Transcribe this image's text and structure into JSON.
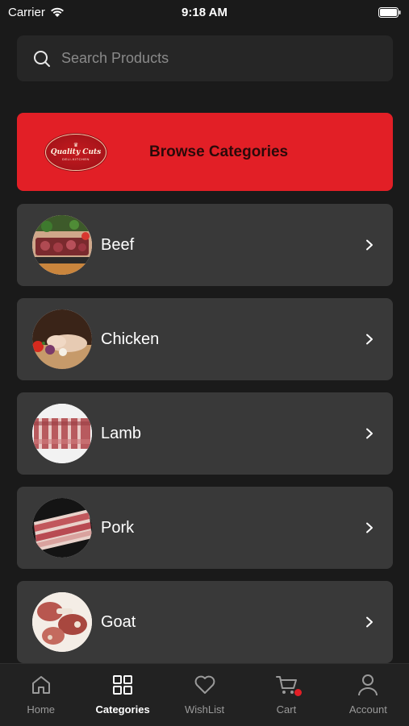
{
  "status": {
    "carrier": "Carrier",
    "time": "9:18 AM"
  },
  "search": {
    "placeholder": "Search Products"
  },
  "banner": {
    "title": "Browse Categories",
    "logo_text": "Quality Cuts",
    "logo_subtext": "DELI-KITCHEN"
  },
  "categories": [
    {
      "label": "Beef"
    },
    {
      "label": "Chicken"
    },
    {
      "label": "Lamb"
    },
    {
      "label": "Pork"
    },
    {
      "label": "Goat"
    }
  ],
  "tabbar": {
    "items": [
      {
        "label": "Home",
        "icon": "home-icon"
      },
      {
        "label": "Categories",
        "icon": "grid-icon",
        "active": true
      },
      {
        "label": "WishList",
        "icon": "heart-icon"
      },
      {
        "label": "Cart",
        "icon": "cart-icon"
      },
      {
        "label": "Account",
        "icon": "user-icon"
      }
    ]
  },
  "colors": {
    "accent": "#e21f26",
    "background": "#1a1a1a",
    "card": "#393939"
  }
}
